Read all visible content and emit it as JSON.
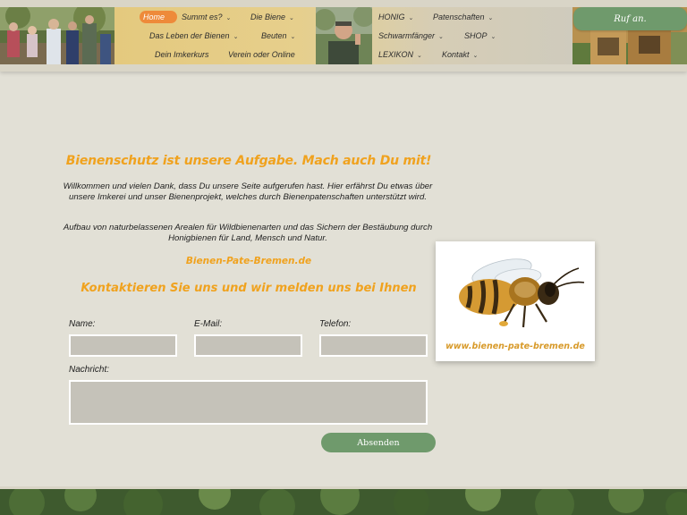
{
  "header": {
    "nav": {
      "home": "Home",
      "summt_es": "Summt es?",
      "die_biene": "Die Biene",
      "leben": "Das Leben der Bienen",
      "beuten": "Beuten",
      "imkerkurs": "Dein Imkerkurs",
      "verein": "Verein oder Online",
      "honig": "HONIG",
      "patenschaften": "Patenschaften",
      "schwarmfaenger": "Schwarmfänger",
      "shop": "SHOP",
      "lexikon": "LEXIKON",
      "kontakt": "Kontakt"
    },
    "call_button": "Ruf an."
  },
  "main": {
    "headline": "Bienenschutz ist unsere Aufgabe. Mach auch Du mit!",
    "intro": "Willkommen und vielen Dank, dass Du unsere Seite aufgerufen hast. Hier erfährst Du etwas über unsere Imkerei und unser Bienenprojekt, welches durch Bienenpatenschaften unterstützt wird.",
    "mission": "Aufbau von naturbelassenen Arealen für Wildbienenarten und das Sichern der Bestäubung durch Honigbienen für Land, Mensch und Natur.",
    "site_link": "Bienen-Pate-Bremen.de",
    "contact_title": "Kontaktieren Sie uns und wir melden uns bei Ihnen",
    "bee_caption": "www.bienen-pate-bremen.de"
  },
  "form": {
    "name_label": "Name:",
    "email_label": "E-Mail:",
    "phone_label": "Telefon:",
    "message_label": "Nachricht:",
    "submit_label": "Absenden"
  },
  "colors": {
    "accent_orange": "#f0a21e",
    "button_green": "#6f9a6c",
    "home_pill": "#ee8a3a",
    "background": "#e2e0d6"
  },
  "icons": {
    "chevron": "chevron-down-icon"
  }
}
